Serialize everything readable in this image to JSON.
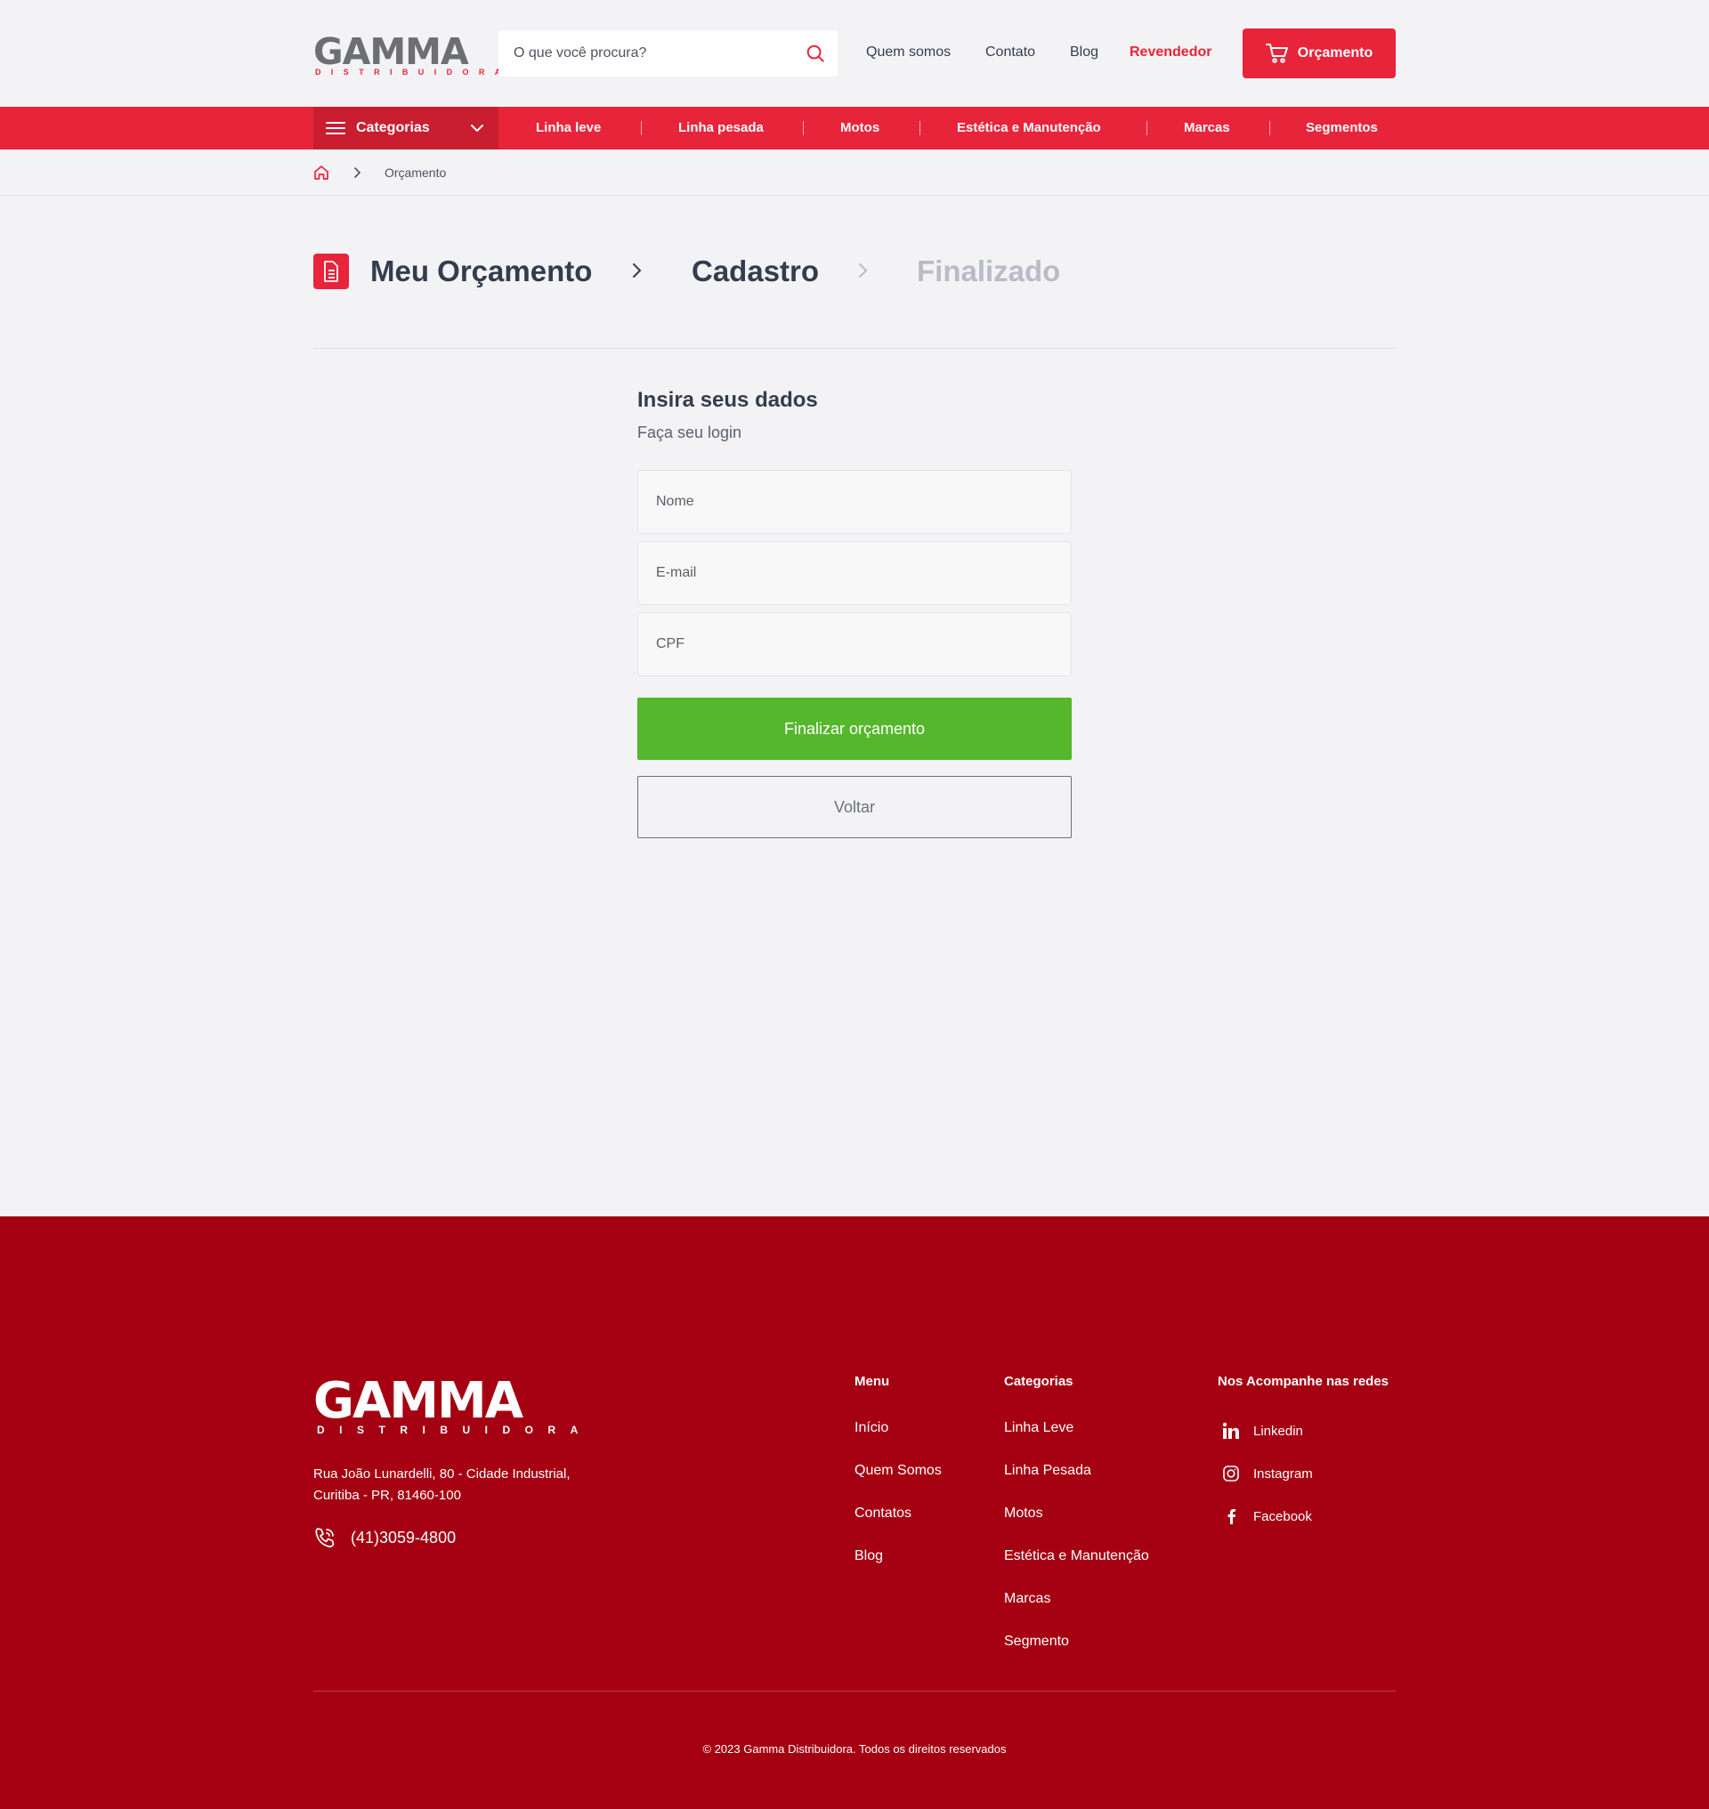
{
  "header": {
    "logo_word": "GAMMA",
    "logo_sub": "DISTRIBUIDORA",
    "search_placeholder": "O que você procura?",
    "nav": [
      "Quem somos",
      "Contato",
      "Blog",
      "Revendedor"
    ],
    "cart_label": "Orçamento"
  },
  "categories_bar": {
    "button_label": "Categorias",
    "items": [
      "Linha leve",
      "Linha pesada",
      "Motos",
      "Estética e Manutenção",
      "Marcas",
      "Segmentos"
    ]
  },
  "breadcrumb": {
    "current": "Orçamento"
  },
  "steps": [
    "Meu Orçamento",
    "Cadastro",
    "Finalizado"
  ],
  "form": {
    "title": "Insira seus dados",
    "subtitle": "Faça seu login",
    "fields": [
      {
        "placeholder": "Nome"
      },
      {
        "placeholder": "E-mail"
      },
      {
        "placeholder": "CPF"
      }
    ],
    "submit_label": "Finalizar orçamento",
    "back_label": "Voltar"
  },
  "footer": {
    "logo_word": "GAMMA",
    "logo_sub": "DISTRIBUIDORA",
    "address_line1": "Rua João Lunardelli, 80 - Cidade Industrial,",
    "address_line2": "Curitiba - PR, 81460-100",
    "phone": "(41)3059-4800",
    "menu_title": "Menu",
    "menu": [
      "Início",
      "Quem Somos",
      "Contatos",
      "Blog"
    ],
    "categories_title": "Categorias",
    "categories": [
      "Linha Leve",
      "Linha Pesada",
      "Motos",
      "Estética e Manutenção",
      "Marcas",
      "Segmento"
    ],
    "social_title": "Nos Acompanhe nas redes",
    "social": [
      "Linkedin",
      "Instagram",
      "Facebook"
    ],
    "copyright": "© 2023 Gamma Distribuidora. Todos os direitos reservados"
  },
  "colors": {
    "brand_red": "#e8243a",
    "footer_red": "#a50012",
    "success_green": "#55b72c",
    "text_dark": "#343c4e"
  },
  "icons": [
    "search-icon",
    "cart-icon",
    "menu-icon",
    "chevron-down-icon",
    "home-icon",
    "chevron-right-icon",
    "document-icon",
    "phone-icon",
    "linkedin-icon",
    "instagram-icon",
    "facebook-icon"
  ]
}
